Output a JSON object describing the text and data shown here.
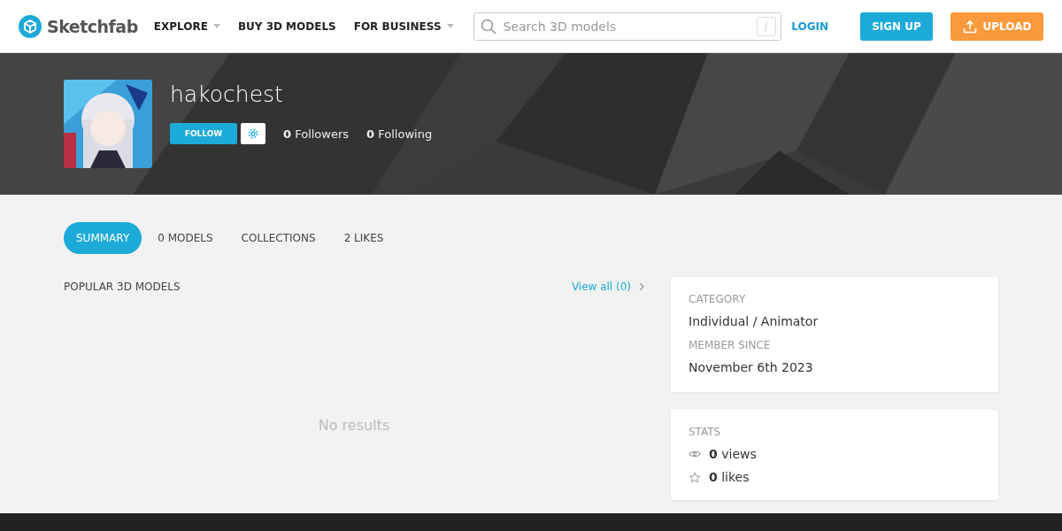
{
  "header": {
    "logo": "Sketchfab",
    "nav": [
      {
        "label": "EXPLORE",
        "dropdown": true
      },
      {
        "label": "BUY 3D MODELS",
        "dropdown": false
      },
      {
        "label": "FOR BUSINESS",
        "dropdown": true
      }
    ],
    "search": {
      "placeholder": "Search 3D models",
      "shortcut": "/"
    },
    "login": "LOGIN",
    "signup": "SIGN UP",
    "upload": "UPLOAD"
  },
  "profile": {
    "username": "hakochest",
    "follow": "FOLLOW",
    "followers": "**0** Followers",
    "following": "**0** Following"
  },
  "tabs": [
    {
      "label": "SUMMARY",
      "selected": true
    },
    {
      "label": "0 MODELS",
      "selected": false
    },
    {
      "label": "COLLECTIONS",
      "selected": false
    },
    {
      "label": "2 LIKES",
      "selected": false
    }
  ],
  "popular": {
    "title": "POPULAR 3D MODELS",
    "view_all": "View all (0)",
    "empty": "No results"
  },
  "info": [
    {
      "label": "CATEGORY",
      "value": "Individual / Animator"
    },
    {
      "label": "MEMBER SINCE",
      "value": "November 6th 2023"
    }
  ],
  "stats": {
    "title": "STATS",
    "items": [
      {
        "kind": "views",
        "text": "**0** views"
      },
      {
        "kind": "likes",
        "text": "**0** likes"
      }
    ]
  }
}
